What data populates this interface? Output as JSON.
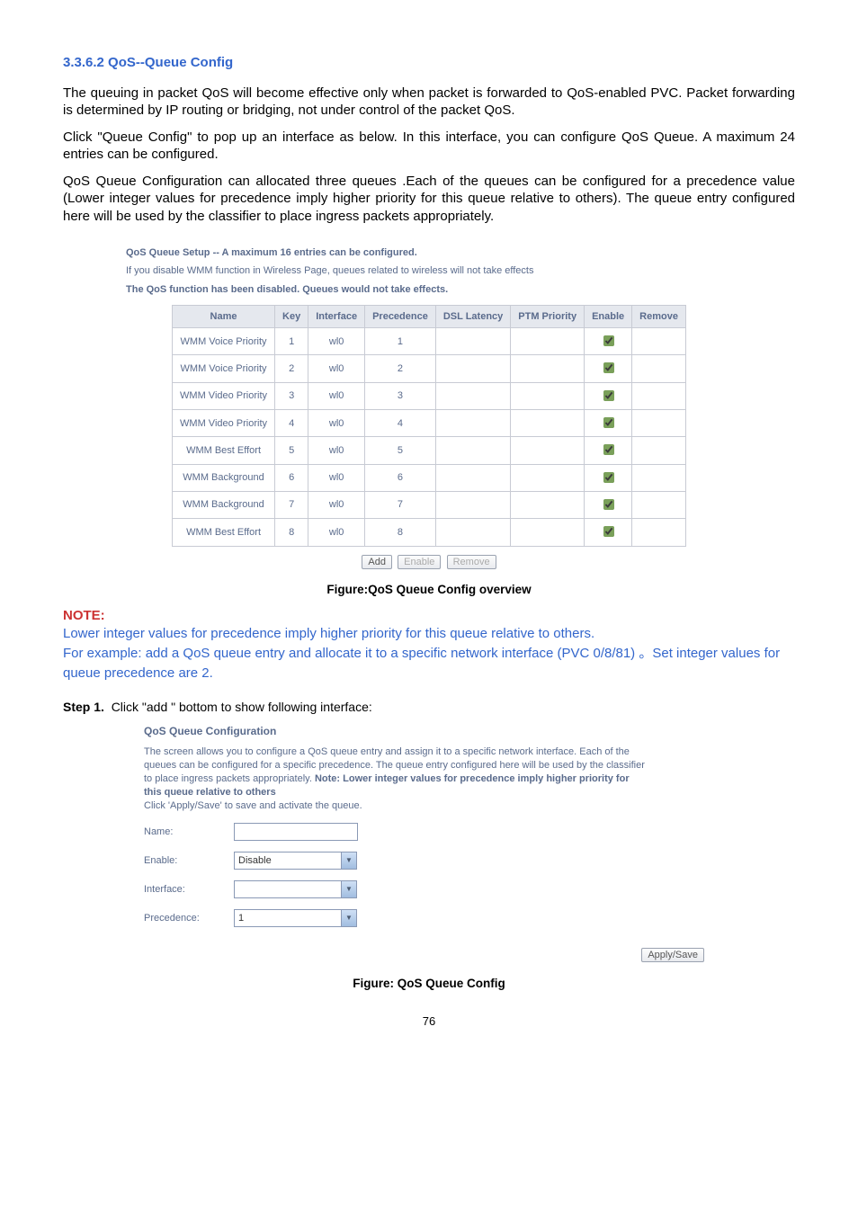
{
  "heading": "3.3.6.2 QoS--Queue Config",
  "para1": "The queuing in packet QoS will become effective only when packet is forwarded to QoS-enabled PVC. Packet forwarding is determined by IP routing or bridging, not under control of the packet QoS.",
  "para2": "Click \"Queue Config\" to pop up an interface as below. In this interface, you can configure QoS Queue. A maximum 24 entries can be configured.",
  "para3": "QoS Queue Configuration can allocated three queues .Each of the queues can be configured for a precedence value (Lower integer values for precedence imply higher priority for this queue relative to others). The queue entry configured here will be used by the classifier to place ingress packets appropriately.",
  "setup": {
    "title": "QoS Queue Setup -- A maximum 16 entries can be configured.",
    "note": "If you disable WMM function in Wireless Page, queues related to wireless will not take effects",
    "disabled": "The QoS function has been disabled. Queues would not take effects."
  },
  "table": {
    "headers": [
      "Name",
      "Key",
      "Interface",
      "Precedence",
      "DSL Latency",
      "PTM Priority",
      "Enable",
      "Remove"
    ],
    "rows": [
      {
        "name": "WMM Voice Priority",
        "key": "1",
        "iface": "wl0",
        "prec": "1"
      },
      {
        "name": "WMM Voice Priority",
        "key": "2",
        "iface": "wl0",
        "prec": "2"
      },
      {
        "name": "WMM Video Priority",
        "key": "3",
        "iface": "wl0",
        "prec": "3"
      },
      {
        "name": "WMM Video Priority",
        "key": "4",
        "iface": "wl0",
        "prec": "4"
      },
      {
        "name": "WMM Best Effort",
        "key": "5",
        "iface": "wl0",
        "prec": "5"
      },
      {
        "name": "WMM Background",
        "key": "6",
        "iface": "wl0",
        "prec": "6"
      },
      {
        "name": "WMM Background",
        "key": "7",
        "iface": "wl0",
        "prec": "7"
      },
      {
        "name": "WMM Best Effort",
        "key": "8",
        "iface": "wl0",
        "prec": "8"
      }
    ]
  },
  "buttons": {
    "add": "Add",
    "enable": "Enable",
    "remove": "Remove"
  },
  "fig1": "Figure:QoS Queue Config overview",
  "note_label": "NOTE:",
  "blue1": "Lower integer values for precedence imply higher priority for this queue relative to others.",
  "blue2": "For example: add a QoS queue entry and allocate it to a specific network interface (PVC 0/8/81) 。Set integer values for queue precedence are 2.",
  "step1_label": "Step 1.",
  "step1_text": "Click \"add \" bottom to show following interface:",
  "conf": {
    "title": "QoS Queue Configuration",
    "desc1": "The screen allows you to configure a QoS queue entry and assign it to a specific network interface. Each of the queues can be configured for a specific precedence. The queue entry configured here will be used by the classifier to place ingress packets appropriately. ",
    "desc_strong": "Note: Lower integer values for precedence imply higher priority for this queue relative to others",
    "desc2": "Click 'Apply/Save' to save and activate the queue.",
    "labels": {
      "name": "Name:",
      "enable": "Enable:",
      "interface": "Interface:",
      "precedence": "Precedence:"
    },
    "values": {
      "name": "",
      "enable": "Disable",
      "interface": "",
      "precedence": "1"
    },
    "apply": "Apply/Save"
  },
  "fig2": "Figure: QoS Queue Config",
  "pagenum": "76"
}
